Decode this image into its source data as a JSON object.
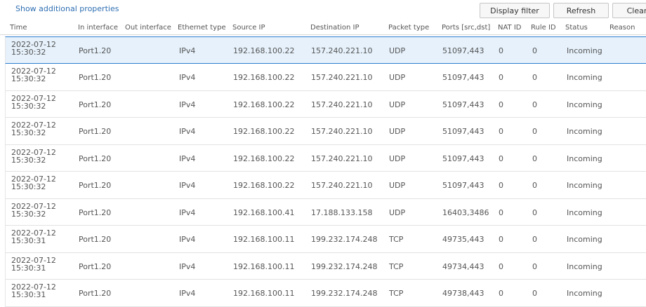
{
  "toolbar": {
    "show_additional": "Show additional properties",
    "display_filter": "Display filter",
    "refresh": "Refresh",
    "clear": "Clear"
  },
  "columns": {
    "time": "Time",
    "in_iface": "In interface",
    "out_iface": "Out interface",
    "eth_type": "Ethernet type",
    "src_ip": "Source IP",
    "dst_ip": "Destination IP",
    "pkt_type": "Packet type",
    "ports": "Ports [src,dst]",
    "nat_id": "NAT ID",
    "rule_id": "Rule ID",
    "status": "Status",
    "reason": "Reason"
  },
  "rows": [
    {
      "date": "2022-07-12",
      "time": "15:30:32",
      "in": "Port1.20",
      "out": "",
      "eth": "IPv4",
      "src": "192.168.100.22",
      "dst": "157.240.221.10",
      "pkt": "UDP",
      "ports": "51097,443",
      "nat": "0",
      "rule": "0",
      "status": "Incoming",
      "reason": ""
    },
    {
      "date": "2022-07-12",
      "time": "15:30:32",
      "in": "Port1.20",
      "out": "",
      "eth": "IPv4",
      "src": "192.168.100.22",
      "dst": "157.240.221.10",
      "pkt": "UDP",
      "ports": "51097,443",
      "nat": "0",
      "rule": "0",
      "status": "Incoming",
      "reason": ""
    },
    {
      "date": "2022-07-12",
      "time": "15:30:32",
      "in": "Port1.20",
      "out": "",
      "eth": "IPv4",
      "src": "192.168.100.22",
      "dst": "157.240.221.10",
      "pkt": "UDP",
      "ports": "51097,443",
      "nat": "0",
      "rule": "0",
      "status": "Incoming",
      "reason": ""
    },
    {
      "date": "2022-07-12",
      "time": "15:30:32",
      "in": "Port1.20",
      "out": "",
      "eth": "IPv4",
      "src": "192.168.100.22",
      "dst": "157.240.221.10",
      "pkt": "UDP",
      "ports": "51097,443",
      "nat": "0",
      "rule": "0",
      "status": "Incoming",
      "reason": ""
    },
    {
      "date": "2022-07-12",
      "time": "15:30:32",
      "in": "Port1.20",
      "out": "",
      "eth": "IPv4",
      "src": "192.168.100.22",
      "dst": "157.240.221.10",
      "pkt": "UDP",
      "ports": "51097,443",
      "nat": "0",
      "rule": "0",
      "status": "Incoming",
      "reason": ""
    },
    {
      "date": "2022-07-12",
      "time": "15:30:32",
      "in": "Port1.20",
      "out": "",
      "eth": "IPv4",
      "src": "192.168.100.22",
      "dst": "157.240.221.10",
      "pkt": "UDP",
      "ports": "51097,443",
      "nat": "0",
      "rule": "0",
      "status": "Incoming",
      "reason": ""
    },
    {
      "date": "2022-07-12",
      "time": "15:30:32",
      "in": "Port1.20",
      "out": "",
      "eth": "IPv4",
      "src": "192.168.100.41",
      "dst": "17.188.133.158",
      "pkt": "UDP",
      "ports": "16403,3486",
      "nat": "0",
      "rule": "0",
      "status": "Incoming",
      "reason": ""
    },
    {
      "date": "2022-07-12",
      "time": "15:30:31",
      "in": "Port1.20",
      "out": "",
      "eth": "IPv4",
      "src": "192.168.100.11",
      "dst": "199.232.174.248",
      "pkt": "TCP",
      "ports": "49735,443",
      "nat": "0",
      "rule": "0",
      "status": "Incoming",
      "reason": ""
    },
    {
      "date": "2022-07-12",
      "time": "15:30:31",
      "in": "Port1.20",
      "out": "",
      "eth": "IPv4",
      "src": "192.168.100.11",
      "dst": "199.232.174.248",
      "pkt": "TCP",
      "ports": "49734,443",
      "nat": "0",
      "rule": "0",
      "status": "Incoming",
      "reason": ""
    },
    {
      "date": "2022-07-12",
      "time": "15:30:31",
      "in": "Port1.20",
      "out": "",
      "eth": "IPv4",
      "src": "192.168.100.11",
      "dst": "199.232.174.248",
      "pkt": "TCP",
      "ports": "49738,443",
      "nat": "0",
      "rule": "0",
      "status": "Incoming",
      "reason": ""
    }
  ]
}
